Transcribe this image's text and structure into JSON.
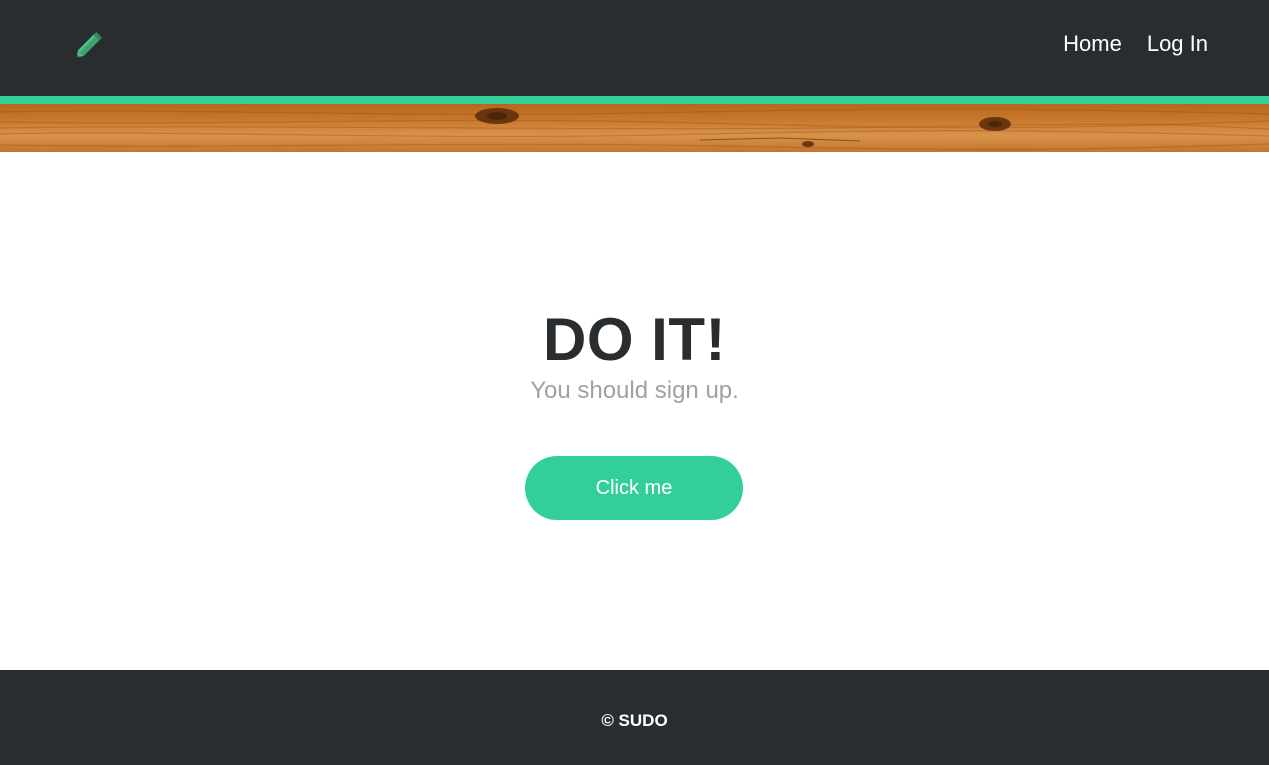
{
  "header": {
    "logo_icon": "pencil-icon",
    "nav": {
      "home_label": "Home",
      "login_label": "Log In"
    }
  },
  "banner": {
    "image": "wood-texture"
  },
  "hero": {
    "title": "DO IT!",
    "subtitle": "You should sign up.",
    "button_label": "Click me"
  },
  "footer": {
    "text": "© SUDO"
  },
  "colors": {
    "dark": "#2a2d2f",
    "accent": "#33cf98",
    "muted_text": "#a1a1a1",
    "white": "#ffffff"
  }
}
